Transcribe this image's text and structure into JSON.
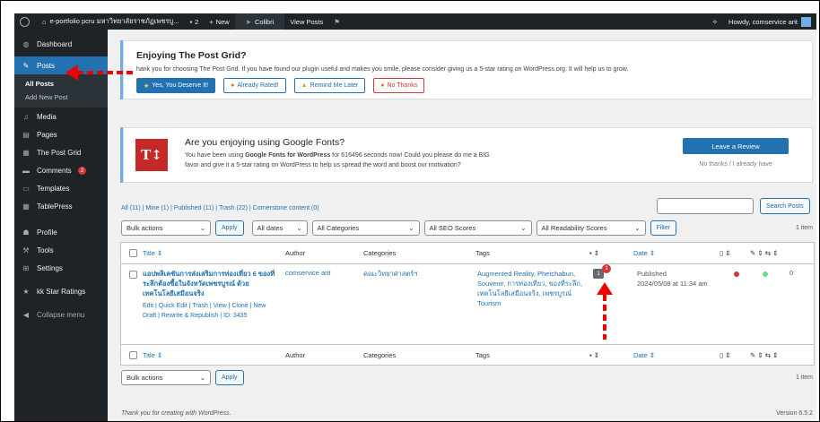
{
  "adminbar": {
    "site": "e-portfolio pcru มหาวิทยาลัยราชภัฏเพชรบู...",
    "comments_count": "2",
    "new_label": "New",
    "colibri_label": "Colibri",
    "view_posts_label": "View Posts",
    "howdy": "Howdy, comservice arit"
  },
  "sidebar": {
    "dashboard": "Dashboard",
    "posts": "Posts",
    "all_posts": "All Posts",
    "add_new_post": "Add New Post",
    "media": "Media",
    "pages": "Pages",
    "post_grid": "The Post Grid",
    "comments": "Comments",
    "comments_badge": "2",
    "templates": "Templates",
    "tablepress": "TablePress",
    "profile": "Profile",
    "tools": "Tools",
    "settings": "Settings",
    "kk_star": "kk Star Ratings",
    "collapse": "Collapse menu"
  },
  "postgrid_notice": {
    "title": "Enjoying The Post Grid?",
    "text": "hank you for choosing The Post Grid. If you have found our plugin useful and makes you smile, please consider giving us a 5-star rating on WordPress.org. It will help us to grow.",
    "btn_yes": "Yes, You Deserve It!",
    "btn_rated": "Already Rated!",
    "btn_later": "Remind Me Later",
    "btn_no": "No Thanks"
  },
  "fonts_notice": {
    "logo": "T↕",
    "title": "Are you enjoying using Google Fonts?",
    "text_pre": "You have been using ",
    "text_bold": "Google Fonts for WordPress",
    "text_post": " for 616496 seconds now! Could you please do me a BIG",
    "text_line2": "favor and give it a 5-star rating on WordPress to help us spread the word and boost our motivation?",
    "review_btn": "Leave a Review",
    "no_thanks": "No thanks / I already have"
  },
  "filters": {
    "views": "All (11) | Mine (1) | Published (11) | Trash (22) | Cornerstone content (0)",
    "search_btn": "Search Posts",
    "bulk_actions": "Bulk actions",
    "apply": "Apply",
    "all_dates": "All dates",
    "all_categories": "All Categories",
    "seo_scores": "All SEO Scores",
    "readability": "All Readability Scores",
    "filter_btn": "Filter",
    "item_count": "1 item"
  },
  "table": {
    "headers": {
      "title": "Title ⇕",
      "author": "Author",
      "categories": "Categories",
      "tags": "Tags",
      "date": "Date ⇕"
    },
    "row": {
      "title": "แอปพลิเคชันการส่งเสริมการท่องเที่ยว 6 ของที่ระลึกต้องซื้อในจังหวัดเพชรบูรณ์ ด้วยเทคโนโลยีเสมือนจริง",
      "actions": "Edit | Quick Edit | Trash | View | Clone | New Draft | Rewrite & Republish | ID: 3435",
      "author": "comservice arit",
      "category": "คณะวิทยาศาสตร์ฯ",
      "tags": "Augmented Reality, Phetchabun, Souvenir, การท่องเที่ยว, ของที่ระลึก, เทคโนโลยีเสมือนจริง, เพชรบูรณ์ Tourism",
      "comment_count": "1",
      "comment_badge": "1",
      "date_status": "Published",
      "date_value": "2024/05/08 at 11:34 am",
      "links": "0"
    }
  },
  "footer": {
    "thank_you": "Thank you for creating with WordPress.",
    "version": "Version 6.5.2"
  },
  "colors": {
    "accent": "#2271b1",
    "admin_dark": "#1d2327",
    "annotation": "#e00000",
    "seo_red": "#d63638",
    "readability_green": "#68de7c"
  }
}
